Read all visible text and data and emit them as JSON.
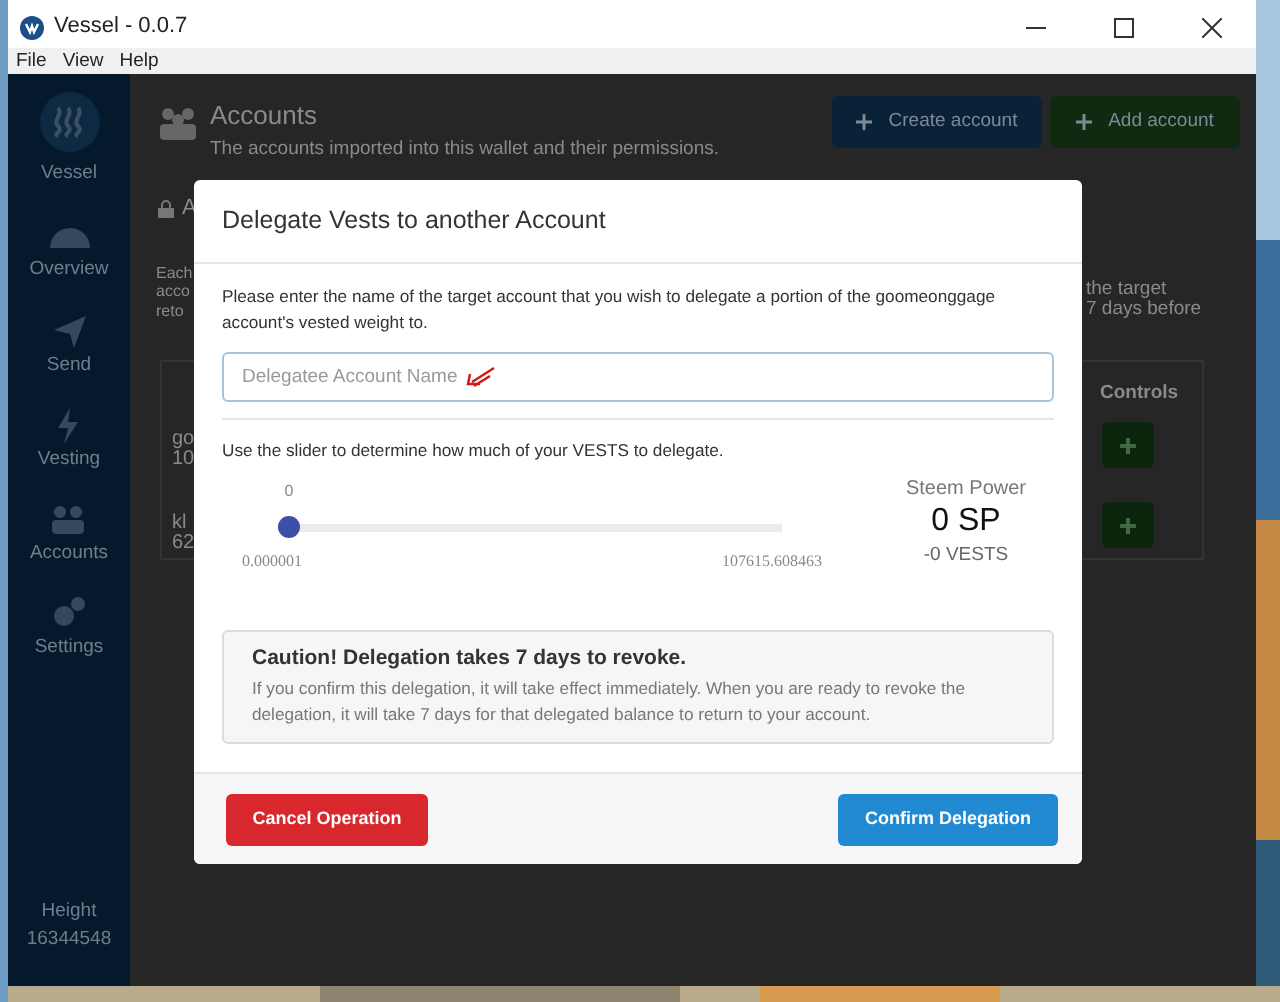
{
  "window": {
    "title": "Vessel - 0.0.7"
  },
  "menu": [
    "File",
    "View",
    "Help"
  ],
  "sidebar": {
    "brand": "Vessel",
    "items": [
      {
        "kind": "gauge",
        "label": "Overview"
      },
      {
        "kind": "plane",
        "label": "Send"
      },
      {
        "kind": "bolt",
        "label": "Vesting"
      },
      {
        "kind": "users",
        "label": "Accounts"
      },
      {
        "kind": "gears",
        "label": "Settings"
      }
    ],
    "height_label": "Height",
    "height_value": "16344548"
  },
  "page": {
    "title": "Accounts",
    "subtitle": "The accounts imported into this wallet and their permissions.",
    "buttons": [
      {
        "kind": "create",
        "label": "Create account"
      },
      {
        "kind": "add",
        "label": "Add account"
      }
    ],
    "tab": "A",
    "intro_fragments": [
      "Each",
      "acco",
      "reto"
    ],
    "right_fragments": [
      "the target",
      "7 days before"
    ],
    "table": {
      "columns": [
        "Controls"
      ],
      "rows": [
        [
          "go",
          "10"
        ],
        [
          "kl",
          "62"
        ]
      ]
    }
  },
  "dialog": {
    "title": "Delegate Vests to another Account",
    "intro": "Please enter the name of the target account that you wish to delegate a portion of the goomeonggage account's vested weight to.",
    "input": {
      "placeholder": "Delegatee Account Name"
    },
    "slider_help": "Use the slider to determine how much of your VESTS to delegate.",
    "slider": {
      "level": 0,
      "value_label": "0",
      "min_label": "0.000001",
      "max_label": "107615.608463"
    },
    "power": {
      "label": "Steem Power",
      "amount": "0 SP",
      "vests": "-0 VESTS"
    },
    "caution": {
      "title": "Caution! Delegation takes 7 days to revoke.",
      "text": "If you confirm this delegation, it will take effect immediately. When you are ready to revoke the delegation, it will take 7 days for that delegated balance to return to your account."
    },
    "buttons": [
      {
        "kind": "cancel",
        "label": "Cancel Operation"
      },
      {
        "kind": "confirm",
        "label": "Confirm Delegation"
      }
    ]
  }
}
